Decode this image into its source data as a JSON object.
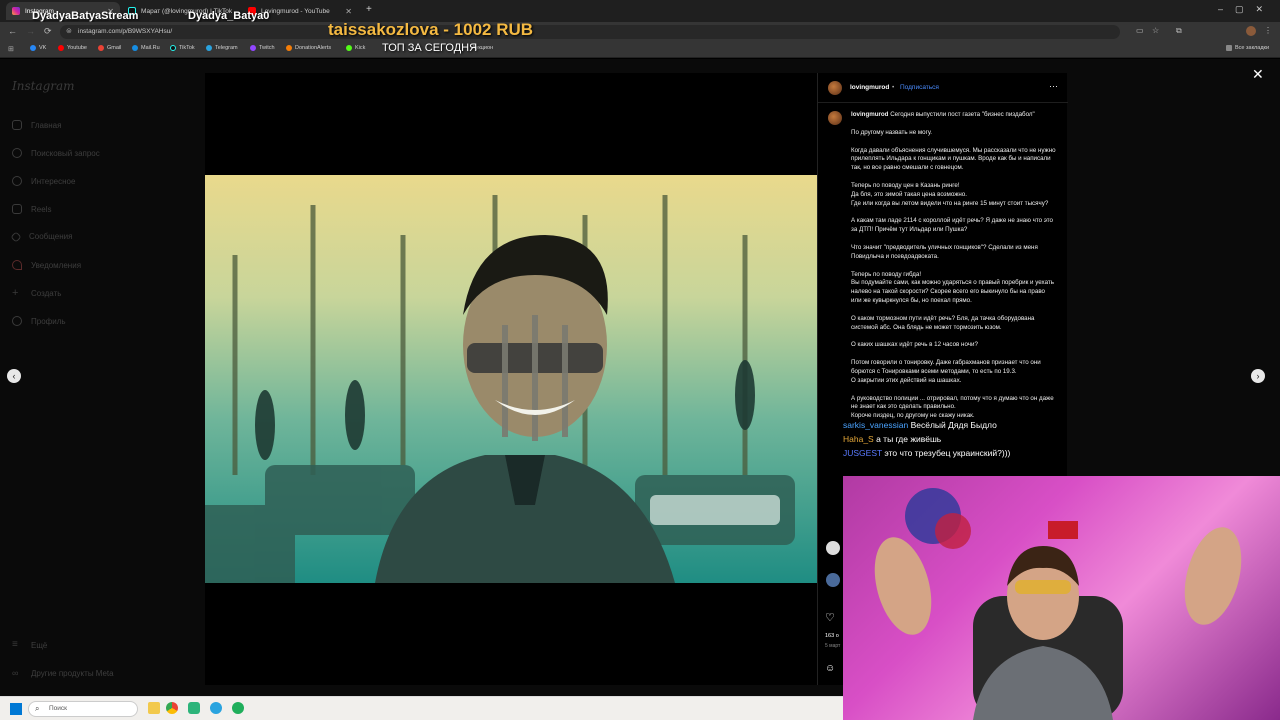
{
  "stream": {
    "channel_name": "DyadyaBatyaStream",
    "channel_name2": "Dyadya_Batya0",
    "donation": "taissakozlova - 1002 RUB",
    "top_label": "ТОП ЗА СЕГОДНЯ"
  },
  "browser": {
    "tabs": [
      {
        "label": "Instagram",
        "active": true
      },
      {
        "label": "Марат (@lovingmurod) | TikTok",
        "active": false
      },
      {
        "label": "Lovingmurod - YouTube",
        "active": false
      }
    ],
    "new_tab": "+",
    "url": "instagram.com/p/B9WSXYAHsu/",
    "bookmarks": [
      "VK",
      "Youtube",
      "Gmail",
      "Mail.Ru",
      "TikTok",
      "Telegram",
      "Twitch",
      "DonationAlerts",
      "Kick",
      "Аукцион"
    ],
    "all_bookmarks": "Все закладки"
  },
  "instagram": {
    "logo": "Instagram",
    "nav": [
      "Главная",
      "Поисковый запрос",
      "Интересное",
      "Reels",
      "Сообщения",
      "Уведомления",
      "Создать",
      "Профиль"
    ],
    "nav_bottom": [
      "Ещё",
      "Другие продукты Meta"
    ],
    "post": {
      "username": "lovingmurod",
      "follow": "Подписаться",
      "more": "···",
      "caption_user": "lovingmurod",
      "caption_first": "Сегодня выпустили пост газета \"бизнес пиздабол\"",
      "paragraphs": [
        "По другому назвать не могу.",
        "Когда давали объяснения случившемуся. Мы рассказали что не нужно прилеплять Ильдара к гонщикам и пушкам. Вроде как бы и написали так, но все равно смешали с говнецом.",
        "Теперь по поводу цен в Казань ринге!\nДа бля, это зимой такая цена возможно.\nГде или когда вы летом видели что на ринге 15 минут стоит тысячу?",
        "А какам там ладе 2114 с короллой идёт речь? Я даже не знаю что это за ДТП! Причём тут Ильдар или Пушка?",
        "Что значит \"предводитель уличных гонщиков\"? Сделали из меня Повидлыча и псевдоадвоката.",
        "Теперь по поводу гибда!\nВы подумайте сами, как можно ударяться о правый поребрик и уехать налево на такой скорости? Скорее всего его выкинуло бы на право или же кувыркнулся бы, но поехал прямо.",
        "О каком тормозном пути идёт речь? Бля, да тачка оборудована системой абс. Она блядь не может тормозить юзом.",
        "О каких шашках идёт речь в 12 часов ночи?",
        "Потом говорили о тонировку. Даже габрахманов признает что они борются с Тонировками всеми методами, то есть по 19.3.\nО закрытии этих действий на шашках.",
        "А руководство полиции ... отрировал, потому что я думаю что он даже не знает как это сделать правильно.\nКороче пиздец, по другому не скажу никак."
      ],
      "likes": "163 о",
      "date": "5 март"
    }
  },
  "chat": [
    {
      "user": "sarkis_vanessian",
      "text": "Весёлый Дядя Быдло"
    },
    {
      "user": "Haha_S",
      "text": "а ты где живёшь"
    },
    {
      "user": "JUSGEST",
      "text": "это что трезубец украинский?)))"
    }
  ],
  "taskbar": {
    "search_placeholder": "Поиск"
  }
}
